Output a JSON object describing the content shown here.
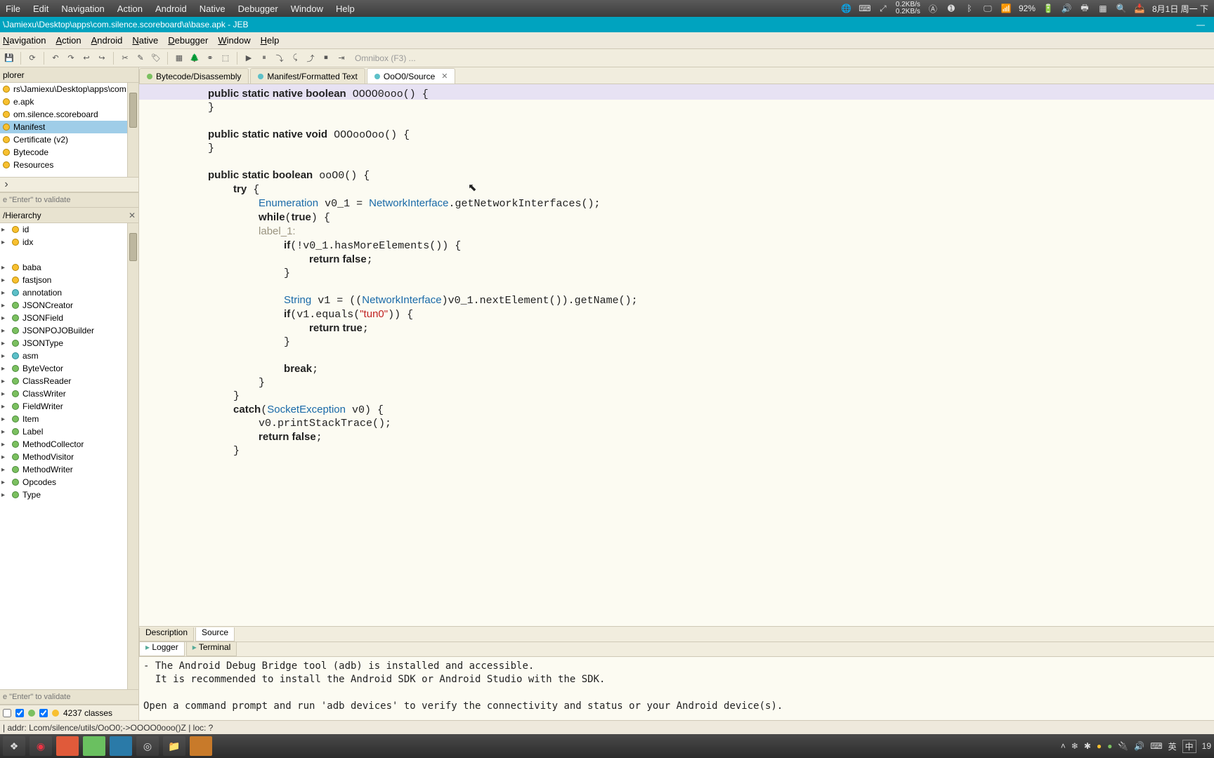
{
  "sysmenu": {
    "items": [
      "File",
      "Edit",
      "Navigation",
      "Action",
      "Android",
      "Native",
      "Debugger",
      "Window",
      "Help"
    ]
  },
  "systray": {
    "net_up": "0.2KB/s",
    "net_down": "0.2KB/s",
    "battery": "92%",
    "date": "8月1日 周一 下"
  },
  "titlebar": {
    "path": "\\Jamiexu\\Desktop\\apps\\com.silence.scoreboard\\a\\base.apk - JEB"
  },
  "appmenu": {
    "items": [
      "Navigation",
      "Action",
      "Android",
      "Native",
      "Debugger",
      "Window",
      "Help"
    ]
  },
  "omnibox": "Omnibox (F3) ...",
  "explorer": {
    "title": "plorer",
    "rows": [
      "rs\\Jamiexu\\Desktop\\apps\\com",
      "e.apk",
      "om.silence.scoreboard",
      "Manifest",
      "Certificate (v2)",
      "Bytecode",
      "Resources"
    ],
    "filter_placeholder": "e \"Enter\" to validate"
  },
  "hierarchy": {
    "title": "/Hierarchy",
    "rows": [
      "id",
      "idx",
      "",
      "baba",
      "fastjson",
      "annotation",
      "JSONCreator",
      "JSONField",
      "JSONPOJOBuilder",
      "JSONType",
      "asm",
      "ByteVector",
      "ClassReader",
      "ClassWriter",
      "FieldWriter",
      "Item",
      "Label",
      "MethodCollector",
      "MethodVisitor",
      "MethodWriter",
      "Opcodes",
      "Type"
    ],
    "filter_placeholder": "e \"Enter\" to validate"
  },
  "class_count": "4237 classes",
  "editor_tabs": [
    {
      "label": "Bytecode/Disassembly",
      "color": "#7bc060"
    },
    {
      "label": "Manifest/Formatted Text",
      "color": "#5dc0c8"
    },
    {
      "label": "OoO0/Source",
      "color": "#5dc0c8",
      "active": true,
      "closeable": true
    }
  ],
  "code_lines": [
    {
      "indent": 2,
      "tokens": [
        [
          "kw",
          "public static native boolean"
        ],
        [
          "",
          " "
        ],
        [
          "",
          "OOOO0ooo"
        ],
        [
          "",
          "() {"
        ]
      ]
    },
    {
      "indent": 2,
      "tokens": [
        [
          "",
          "}"
        ]
      ]
    },
    {
      "indent": 0,
      "tokens": [
        [
          "",
          ""
        ]
      ]
    },
    {
      "indent": 2,
      "tokens": [
        [
          "kw",
          "public static native void"
        ],
        [
          "",
          " "
        ],
        [
          "",
          "OOOooOoo"
        ],
        [
          "",
          "() {"
        ]
      ]
    },
    {
      "indent": 2,
      "tokens": [
        [
          "",
          "}"
        ]
      ]
    },
    {
      "indent": 0,
      "tokens": [
        [
          "",
          ""
        ]
      ]
    },
    {
      "indent": 2,
      "tokens": [
        [
          "kw",
          "public static boolean"
        ],
        [
          "",
          " "
        ],
        [
          "",
          "ooO0"
        ],
        [
          "",
          "() {"
        ]
      ]
    },
    {
      "indent": 3,
      "tokens": [
        [
          "kw",
          "try"
        ],
        [
          "",
          " {"
        ]
      ]
    },
    {
      "indent": 4,
      "tokens": [
        [
          "type",
          "Enumeration"
        ],
        [
          "",
          " v0_1 = "
        ],
        [
          "type",
          "NetworkInterface"
        ],
        [
          "",
          ".getNetworkInterfaces();"
        ]
      ]
    },
    {
      "indent": 4,
      "tokens": [
        [
          "kw",
          "while"
        ],
        [
          "",
          "("
        ],
        [
          "kw",
          "true"
        ],
        [
          "",
          ") {"
        ]
      ]
    },
    {
      "indent": 4,
      "tokens": [
        [
          "label",
          "label_1:"
        ]
      ]
    },
    {
      "indent": 5,
      "tokens": [
        [
          "kw",
          "if"
        ],
        [
          "",
          "(!v0_1.hasMoreElements()) {"
        ]
      ]
    },
    {
      "indent": 6,
      "tokens": [
        [
          "kw",
          "return false"
        ],
        [
          "",
          ";"
        ]
      ]
    },
    {
      "indent": 5,
      "tokens": [
        [
          "",
          "}"
        ]
      ]
    },
    {
      "indent": 0,
      "tokens": [
        [
          "",
          ""
        ]
      ]
    },
    {
      "indent": 5,
      "tokens": [
        [
          "type",
          "String"
        ],
        [
          "",
          " v1 = (("
        ],
        [
          "type",
          "NetworkInterface"
        ],
        [
          "",
          ")v0_1.nextElement()).getName();"
        ]
      ]
    },
    {
      "indent": 5,
      "tokens": [
        [
          "kw",
          "if"
        ],
        [
          "",
          "(v1.equals("
        ],
        [
          "str",
          "\"tun0\""
        ],
        [
          "",
          ")) {"
        ]
      ]
    },
    {
      "indent": 6,
      "tokens": [
        [
          "kw",
          "return true"
        ],
        [
          "",
          ";"
        ]
      ]
    },
    {
      "indent": 5,
      "tokens": [
        [
          "",
          "}"
        ]
      ]
    },
    {
      "indent": 0,
      "tokens": [
        [
          "",
          ""
        ]
      ]
    },
    {
      "indent": 5,
      "tokens": [
        [
          "kw",
          "break"
        ],
        [
          "",
          ";"
        ]
      ]
    },
    {
      "indent": 4,
      "tokens": [
        [
          "",
          "}"
        ]
      ]
    },
    {
      "indent": 3,
      "tokens": [
        [
          "",
          "}"
        ]
      ]
    },
    {
      "indent": 3,
      "tokens": [
        [
          "kw",
          "catch"
        ],
        [
          "",
          "("
        ],
        [
          "type",
          "SocketException"
        ],
        [
          "",
          " v0) {"
        ]
      ]
    },
    {
      "indent": 4,
      "tokens": [
        [
          "",
          "v0.printStackTrace();"
        ]
      ]
    },
    {
      "indent": 4,
      "tokens": [
        [
          "kw",
          "return false"
        ],
        [
          "",
          ";"
        ]
      ]
    },
    {
      "indent": 3,
      "tokens": [
        [
          "",
          "}"
        ]
      ]
    }
  ],
  "bottom_tabs": [
    "Description",
    "Source"
  ],
  "log_tabs": [
    "Logger",
    "Terminal"
  ],
  "log_text": "- The Android Debug Bridge tool (adb) is installed and accessible.\n  It is recommended to install the Android SDK or Android Studio with the SDK.\n\nOpen a command prompt and run 'adb devices' to verify the connectivity and status or your Android device(s).",
  "status": "| addr: Lcom/silence/utils/OoO0;->OOOO0ooo()Z | loc: ?",
  "ime": {
    "lang": "英",
    "layout": "中"
  },
  "taskbar_time": "19"
}
